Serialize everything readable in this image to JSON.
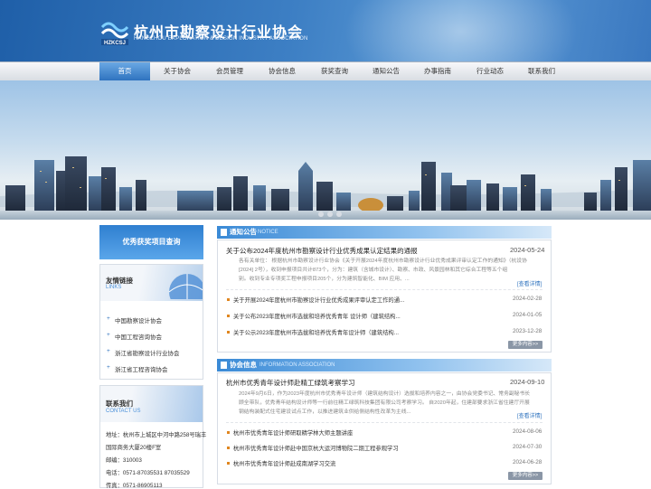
{
  "site": {
    "title": "杭州市勘察设计行业协会",
    "subtitle": "HANGZHOU EXPLORATION & DESIGN INDUSTRY ASSOCIATION",
    "logo_text": "HZKCSJ"
  },
  "nav": {
    "items": [
      "首页",
      "关于协会",
      "会员管理",
      "协会信息",
      "获奖查询",
      "通知公告",
      "办事指南",
      "行业动态",
      "联系我们"
    ],
    "active": "首页"
  },
  "sidebar": {
    "quick_search": "优秀获奖项目查询",
    "links": {
      "title": "友情链接",
      "subtitle": "LINKS",
      "items": [
        "中国勘察设计协会",
        "中国工程咨询协会",
        "浙江省勘察设计行业协会",
        "浙江省工程咨询协会"
      ]
    },
    "contact": {
      "title": "联系我们",
      "subtitle": "CONTACT US",
      "address_1": "地址：杭州市上城区中河中路258号瑞丰",
      "address_2": "国际商务大厦20楼F室",
      "postcode": "邮编：310003",
      "phone": "电话：0571-87035531 87035529",
      "fax": "传真：0571-86905113"
    }
  },
  "notice": {
    "title": "通知公告",
    "title_en": "NOTICE",
    "headline": "关于公布2024年度杭州市勘察设计行业优秀成果认定结果的通报",
    "headline_date": "2024-05-24",
    "excerpt_1": "各有关单位： 根据杭州市勘察设计行业协会《关于开展2024年度杭州市勘察设计行业优秀成果评审认定工作的通知》（杭设协",
    "excerpt_2": "[2024] 2号），收到申报项目共计873个，分为：建筑（含城市设计）、勘察、市政、风景园林和其它综合工程等五个组",
    "excerpt_3": "别。收到专业专项奖工程申报项目205个，分为建筑智能化、BIM 应用、...",
    "more_inline": "[查看详情]",
    "items": [
      {
        "title": "关于开展2024年度杭州市勘察设计行业优秀成果评审认定工作的通...",
        "date": "2024-02-28"
      },
      {
        "title": "关于公布2023年度杭州市选拔和培养优秀青年 设计师（建筑结构...",
        "date": "2024-01-05"
      },
      {
        "title": "关于公示2023年度杭州市选拔和培养优秀青年设计师（建筑结构...",
        "date": "2023-12-28"
      }
    ],
    "more_button": "更多内容>>"
  },
  "info": {
    "title": "协会信息",
    "title_en": "INFORMATION ASSOCIATION",
    "headline": "杭州市优秀青年设计师赴精工绿筑考察学习",
    "headline_date": "2024-09-10",
    "excerpt_1": "2024年9月6日，作为2023年度杭州市优秀青年设计师（建筑结构设计）选拔和培养内容之一，由协会党委书记、常务副秘书长",
    "excerpt_2": "顾全带队，优秀青年结构设计师等一行前往精工绿筑科技集团有限公司考察学习。 自2020年起，住建部要求浙江省住建厅开展",
    "excerpt_3": "钢结构装配式住宅建设试点工作，以推进建筑业供给侧结构性改革为主线...",
    "more_inline": "[查看详情]",
    "items": [
      {
        "title": "杭州市优秀青年设计师研取精学林大师主题讲座",
        "date": "2024-08-06"
      },
      {
        "title": "杭州市优秀青年设计师赴中国京杭大运河博物院二期工程参观学习",
        "date": "2024-07-30"
      },
      {
        "title": "杭州市优秀青年设计师赴成南湖学习交流",
        "date": "2024-06-28"
      }
    ],
    "more_button": "更多内容>>"
  },
  "colors": {
    "primary": "#2f73bf",
    "accent": "#e0861f"
  }
}
